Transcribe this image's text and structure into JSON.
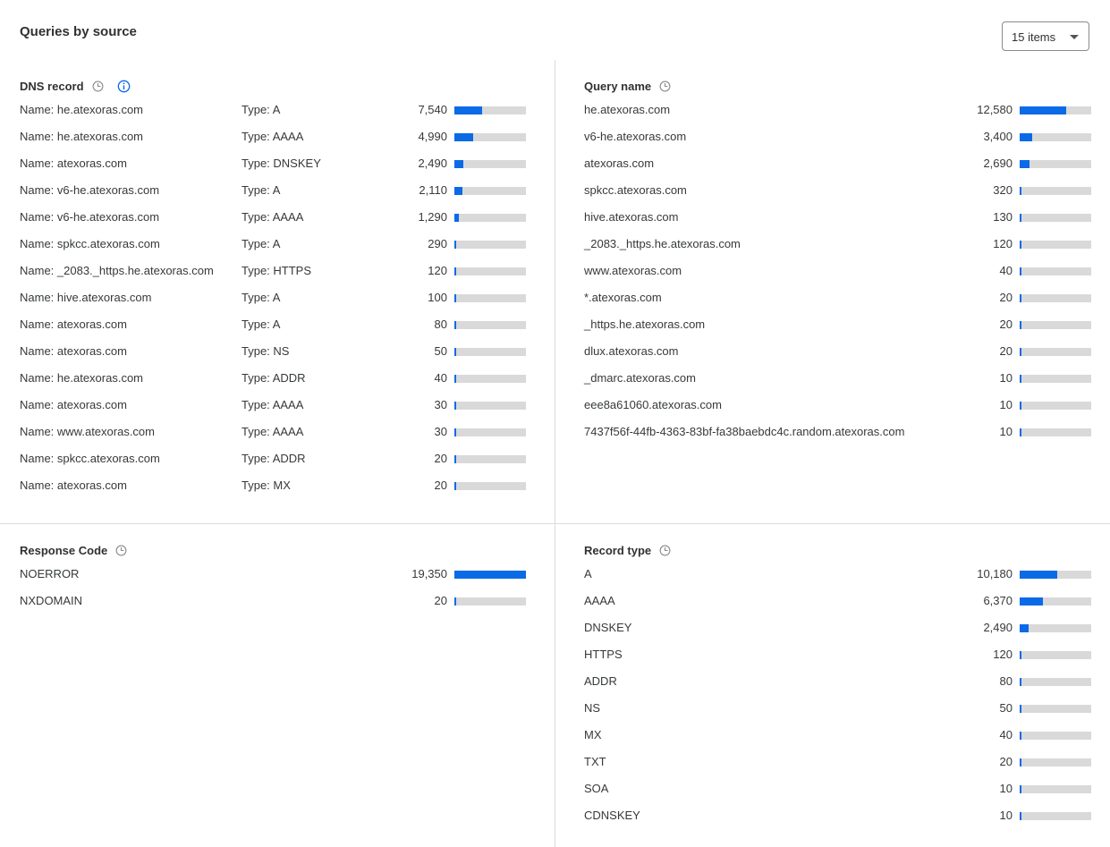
{
  "page": {
    "title": "Queries by source",
    "items_select": {
      "selected": "15 items"
    }
  },
  "colors": {
    "bar_fill": "#0b6ae6",
    "bar_track": "#d9d9d9"
  },
  "dns_record": {
    "title": "DNS record",
    "max": 19350,
    "rows": [
      {
        "name": "Name: he.atexoras.com",
        "type": "Type: A",
        "value_text": "7,540",
        "value": 7540
      },
      {
        "name": "Name: he.atexoras.com",
        "type": "Type: AAAA",
        "value_text": "4,990",
        "value": 4990
      },
      {
        "name": "Name: atexoras.com",
        "type": "Type: DNSKEY",
        "value_text": "2,490",
        "value": 2490
      },
      {
        "name": "Name: v6-he.atexoras.com",
        "type": "Type: A",
        "value_text": "2,110",
        "value": 2110
      },
      {
        "name": "Name: v6-he.atexoras.com",
        "type": "Type: AAAA",
        "value_text": "1,290",
        "value": 1290
      },
      {
        "name": "Name: spkcc.atexoras.com",
        "type": "Type: A",
        "value_text": "290",
        "value": 290
      },
      {
        "name": "Name: _2083._https.he.atexoras.com",
        "type": "Type: HTTPS",
        "value_text": "120",
        "value": 120
      },
      {
        "name": "Name: hive.atexoras.com",
        "type": "Type: A",
        "value_text": "100",
        "value": 100
      },
      {
        "name": "Name: atexoras.com",
        "type": "Type: A",
        "value_text": "80",
        "value": 80
      },
      {
        "name": "Name: atexoras.com",
        "type": "Type: NS",
        "value_text": "50",
        "value": 50
      },
      {
        "name": "Name: he.atexoras.com",
        "type": "Type: ADDR",
        "value_text": "40",
        "value": 40
      },
      {
        "name": "Name: atexoras.com",
        "type": "Type: AAAA",
        "value_text": "30",
        "value": 30
      },
      {
        "name": "Name: www.atexoras.com",
        "type": "Type: AAAA",
        "value_text": "30",
        "value": 30
      },
      {
        "name": "Name: spkcc.atexoras.com",
        "type": "Type: ADDR",
        "value_text": "20",
        "value": 20
      },
      {
        "name": "Name: atexoras.com",
        "type": "Type: MX",
        "value_text": "20",
        "value": 20
      }
    ]
  },
  "query_name": {
    "title": "Query name",
    "max": 19350,
    "rows": [
      {
        "name": "he.atexoras.com",
        "value_text": "12,580",
        "value": 12580
      },
      {
        "name": "v6-he.atexoras.com",
        "value_text": "3,400",
        "value": 3400
      },
      {
        "name": "atexoras.com",
        "value_text": "2,690",
        "value": 2690
      },
      {
        "name": "spkcc.atexoras.com",
        "value_text": "320",
        "value": 320
      },
      {
        "name": "hive.atexoras.com",
        "value_text": "130",
        "value": 130
      },
      {
        "name": "_2083._https.he.atexoras.com",
        "value_text": "120",
        "value": 120
      },
      {
        "name": "www.atexoras.com",
        "value_text": "40",
        "value": 40
      },
      {
        "name": "*.atexoras.com",
        "value_text": "20",
        "value": 20
      },
      {
        "name": "_https.he.atexoras.com",
        "value_text": "20",
        "value": 20
      },
      {
        "name": "dlux.atexoras.com",
        "value_text": "20",
        "value": 20
      },
      {
        "name": "_dmarc.atexoras.com",
        "value_text": "10",
        "value": 10
      },
      {
        "name": "eee8a61060.atexoras.com",
        "value_text": "10",
        "value": 10
      },
      {
        "name": "7437f56f-44fb-4363-83bf-fa38baebdc4c.random.atexoras.com",
        "value_text": "10",
        "value": 10
      }
    ]
  },
  "response_code": {
    "title": "Response Code",
    "max": 19350,
    "rows": [
      {
        "name": "NOERROR",
        "value_text": "19,350",
        "value": 19350
      },
      {
        "name": "NXDOMAIN",
        "value_text": "20",
        "value": 20
      }
    ]
  },
  "record_type": {
    "title": "Record type",
    "max": 19350,
    "rows": [
      {
        "name": "A",
        "value_text": "10,180",
        "value": 10180
      },
      {
        "name": "AAAA",
        "value_text": "6,370",
        "value": 6370
      },
      {
        "name": "DNSKEY",
        "value_text": "2,490",
        "value": 2490
      },
      {
        "name": "HTTPS",
        "value_text": "120",
        "value": 120
      },
      {
        "name": "ADDR",
        "value_text": "80",
        "value": 80
      },
      {
        "name": "NS",
        "value_text": "50",
        "value": 50
      },
      {
        "name": "MX",
        "value_text": "40",
        "value": 40
      },
      {
        "name": "TXT",
        "value_text": "20",
        "value": 20
      },
      {
        "name": "SOA",
        "value_text": "10",
        "value": 10
      },
      {
        "name": "CDNSKEY",
        "value_text": "10",
        "value": 10
      }
    ]
  }
}
